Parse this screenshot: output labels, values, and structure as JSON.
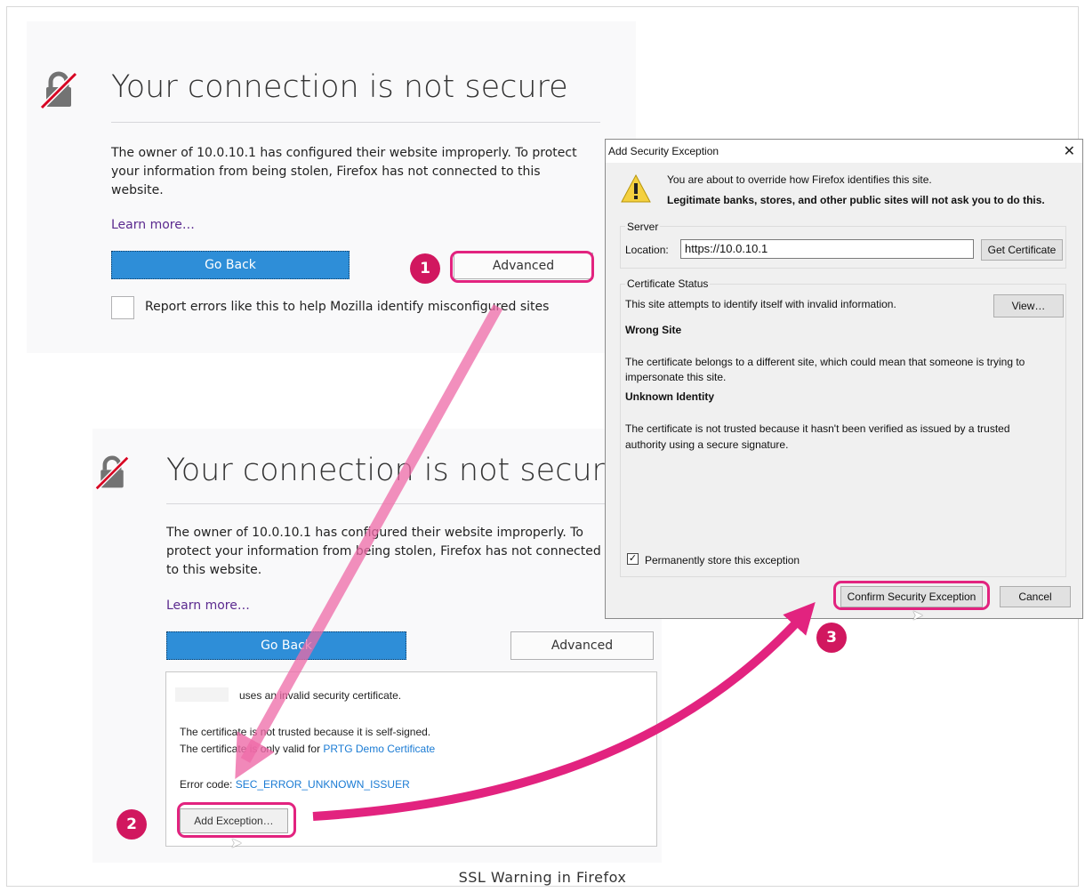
{
  "top_panel": {
    "title": "Your connection is not secure",
    "description": "The owner of 10.0.10.1 has configured their website improperly. To protect your information from being stolen, Firefox has not connected to this website.",
    "learn_more": "Learn more…",
    "go_back": "Go Back",
    "advanced": "Advanced",
    "report_label": "Report errors like this to help Mozilla identify misconfigured sites"
  },
  "bottom_panel": {
    "title": "Your connection is not secure",
    "description": "The owner of 10.0.10.1 has configured their website improperly. To protect your information from being stolen, Firefox has not connected to this website.",
    "learn_more": "Learn more…",
    "go_back": "Go Back",
    "advanced": "Advanced",
    "details": {
      "line1": "uses an invalid security certificate.",
      "line2": "The certificate is not trusted because it is self-signed.",
      "line3_prefix": "The certificate is only valid for ",
      "line3_link": "PRTG Demo Certificate",
      "error_prefix": "Error code: ",
      "error_code": "SEC_ERROR_UNKNOWN_ISSUER",
      "add_exception": "Add Exception…"
    }
  },
  "dialog": {
    "title": "Add Security Exception",
    "close": "✕",
    "warning_line1": "You are about to override how Firefox identifies this site.",
    "warning_line2": "Legitimate banks, stores, and other public sites will not ask you to do this.",
    "server_group": "Server",
    "location_label": "Location:",
    "location_value": "https://10.0.10.1",
    "get_certificate": "Get Certificate",
    "status_group": "Certificate Status",
    "status_text": "This site attempts to identify itself with invalid information.",
    "view": "View…",
    "wrong_site_heading": "Wrong Site",
    "wrong_site_text1": "The certificate belongs to a different site, which could mean that someone is trying to",
    "wrong_site_text2": "impersonate this site.",
    "unknown_heading": "Unknown Identity",
    "unknown_text1": "The certificate is not trusted because it hasn't been verified as issued by a trusted",
    "unknown_text2": "authority using a secure signature.",
    "permanent_label": "Permanently store this exception",
    "confirm": "Confirm Security Exception",
    "cancel": "Cancel"
  },
  "annotations": {
    "step1": "1",
    "step2": "2",
    "step3": "3",
    "color": "#e2237f"
  },
  "caption": "SSL Warning in Firefox"
}
